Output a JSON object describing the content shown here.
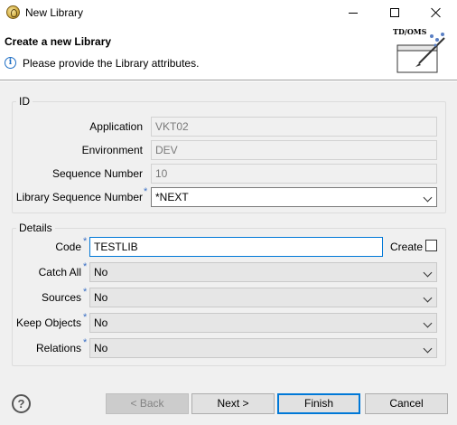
{
  "window": {
    "title": "New Library"
  },
  "header": {
    "title": "Create a new Library",
    "message": "Please provide the Library attributes.",
    "banner_text": "TD/OMS"
  },
  "id_group": {
    "legend": "ID",
    "application": {
      "label": "Application",
      "value": "VKT02"
    },
    "environment": {
      "label": "Environment",
      "value": "DEV"
    },
    "sequence_number": {
      "label": "Sequence Number",
      "value": "10"
    },
    "library_sequence_number": {
      "label": "Library Sequence Number",
      "value": "*NEXT",
      "required_mark": "*"
    }
  },
  "details_group": {
    "legend": "Details",
    "code": {
      "label": "Code",
      "value": "TESTLIB",
      "required_mark": "*"
    },
    "create": {
      "label": "Create",
      "checked": false
    },
    "catch_all": {
      "label": "Catch All",
      "value": "No",
      "required_mark": "*"
    },
    "sources": {
      "label": "Sources",
      "value": "No",
      "required_mark": "*"
    },
    "keep_objects": {
      "label": "Keep Objects",
      "value": "No",
      "required_mark": "*"
    },
    "relations": {
      "label": "Relations",
      "value": "No",
      "required_mark": "*"
    }
  },
  "footer": {
    "help": "?",
    "back": "< Back",
    "next": "Next >",
    "finish": "Finish",
    "cancel": "Cancel"
  },
  "colors": {
    "accent": "#0078d7",
    "required_star": "#3b6fc4",
    "dialog_bg": "#f0f0f0"
  }
}
